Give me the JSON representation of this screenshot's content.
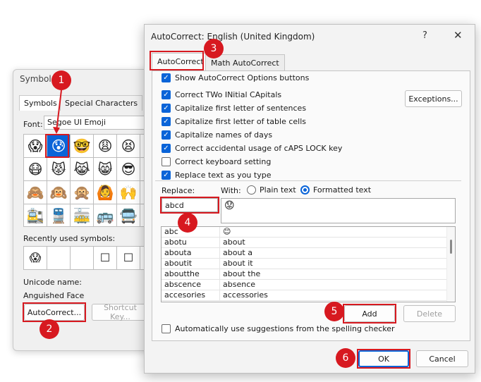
{
  "symbol_dialog": {
    "title": "Symbol",
    "tabs": [
      "Symbols",
      "Special Characters"
    ],
    "font_label": "Font:",
    "font_value": "Segoe UI Emoji",
    "grid": [
      "😱",
      "😰",
      "🤓",
      "😩",
      "😫",
      "😖",
      "😷",
      "😾",
      "😹",
      "😸",
      "😎",
      "😢",
      "🙈",
      "🙉",
      "🙊",
      "🙆",
      "🙌",
      "🙎",
      "🚉",
      "🚆",
      "🚋",
      "🚌",
      "🚍",
      "🚎"
    ],
    "recent_label": "Recently used symbols:",
    "recent": [
      "😱",
      "",
      "",
      "☐",
      "☐",
      "☐"
    ],
    "unicode_label": "Unicode name:",
    "unicode_value": "Anguished Face",
    "autocorrect_button": "AutoCorrect...",
    "shortcut_button": "Shortcut Key..."
  },
  "autocorrect": {
    "title": "AutoCorrect: English (United Kingdom)",
    "help_glyph": "?",
    "close_glyph": "✕",
    "tabs": [
      "AutoCorrect",
      "Math AutoCorrect"
    ],
    "options": [
      {
        "label": "Show AutoCorrect Options buttons",
        "checked": true
      },
      {
        "label": "Correct TWo INitial CApitals",
        "checked": true
      },
      {
        "label": "Capitalize first letter of sentences",
        "checked": true
      },
      {
        "label": "Capitalize first letter of table cells",
        "checked": true
      },
      {
        "label": "Capitalize names of days",
        "checked": true
      },
      {
        "label": "Correct accidental usage of cAPS LOCK key",
        "checked": true
      },
      {
        "label": "Correct keyboard setting",
        "checked": false
      },
      {
        "label": "Replace text as you type",
        "checked": true
      }
    ],
    "exceptions_button": "Exceptions...",
    "replace_label": "Replace:",
    "with_label": "With:",
    "plain_text": "Plain text",
    "formatted_text": "Formatted text",
    "format_selected": "formatted",
    "replace_value": "abcd",
    "with_value": "😟",
    "list_rows": [
      [
        "abc",
        "😊"
      ],
      [
        "abotu",
        "about"
      ],
      [
        "abouta",
        "about a"
      ],
      [
        "aboutit",
        "about it"
      ],
      [
        "aboutthe",
        "about the"
      ],
      [
        "abscence",
        "absence"
      ],
      [
        "accesories",
        "accessories"
      ]
    ],
    "add_button": "Add",
    "delete_button": "Delete",
    "suggestions_label": "Automatically use suggestions from the spelling checker",
    "suggestions_checked": false,
    "ok_button": "OK",
    "cancel_button": "Cancel"
  },
  "annotations": [
    "1",
    "2",
    "3",
    "4",
    "5",
    "6"
  ],
  "colors": {
    "accent": "#0a64d8",
    "annotation": "#d71920"
  }
}
